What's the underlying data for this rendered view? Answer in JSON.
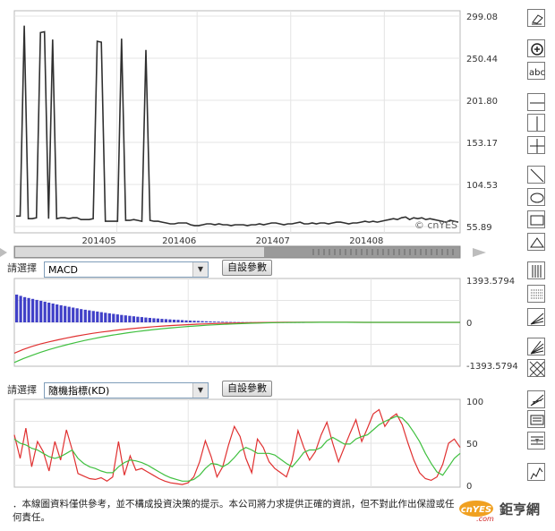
{
  "chart_data": [
    {
      "type": "line",
      "x_ticks": [
        "201405",
        "201406",
        "201407",
        "201408"
      ],
      "y_ticks": [
        "299.08",
        "250.44",
        "201.80",
        "153.17",
        "104.53",
        "55.89"
      ],
      "ylim": [
        55.89,
        299.08
      ],
      "watermark": "© cnYES",
      "series": [
        {
          "values": [
            68,
            68,
            288,
            65,
            65,
            66,
            280,
            281,
            65,
            272,
            65,
            66,
            66,
            65,
            66,
            66,
            64,
            64,
            64,
            65,
            270,
            269,
            62,
            62,
            62,
            62,
            273,
            63,
            63,
            64,
            63,
            62,
            260,
            63,
            62,
            62,
            61,
            60,
            59,
            59,
            60,
            60,
            60,
            58,
            57,
            57,
            58,
            59,
            59,
            58,
            59,
            58,
            58,
            57,
            58,
            58,
            58,
            57,
            58,
            58,
            59,
            58,
            59,
            60,
            60,
            59,
            58,
            59,
            59,
            60,
            61,
            59,
            59,
            60,
            59,
            60,
            60,
            59,
            60,
            61,
            61,
            60,
            59,
            60,
            60,
            61,
            62,
            61,
            62,
            61,
            62,
            63,
            64,
            65,
            64,
            66,
            67,
            64,
            66,
            65,
            66,
            64,
            65,
            64,
            63,
            62,
            61,
            63,
            62,
            61
          ]
        }
      ]
    },
    {
      "type": "bar",
      "selector_label": "請選擇",
      "indicator": "MACD",
      "settings_label": "自設參數",
      "y_ticks": [
        "1393.5794",
        "0",
        "-1393.5794"
      ],
      "ylim": [
        -1393.5794,
        1393.5794
      ],
      "histogram": [
        900,
        860,
        820,
        790,
        760,
        730,
        700,
        670,
        640,
        610,
        580,
        555,
        530,
        505,
        480,
        455,
        430,
        410,
        390,
        370,
        350,
        330,
        310,
        292,
        275,
        258,
        242,
        226,
        211,
        197,
        183,
        170,
        158,
        146,
        135,
        124,
        114,
        105,
        96,
        88,
        80,
        72,
        65,
        58,
        52,
        46,
        41,
        36,
        31,
        27,
        23,
        20,
        17,
        14,
        12,
        10,
        8,
        6,
        5,
        4,
        3,
        2,
        2,
        1,
        1,
        1,
        0,
        0,
        0,
        0,
        0,
        0
      ],
      "series": [
        {
          "color": "#e03030",
          "values": [
            -1000,
            -880,
            -780,
            -700,
            -630,
            -565,
            -505,
            -450,
            -400,
            -355,
            -315,
            -278,
            -245,
            -215,
            -188,
            -163,
            -140,
            -120,
            -102,
            -86,
            -72,
            -59,
            -48,
            -38,
            -29,
            -22,
            -16,
            -11,
            -6,
            -3,
            0,
            2,
            3,
            4,
            4,
            4,
            3,
            3,
            2,
            2,
            1,
            1,
            0,
            0,
            0,
            0,
            0,
            0,
            0,
            0,
            0,
            0
          ]
        },
        {
          "color": "#40c040",
          "values": [
            -1300,
            -1180,
            -1070,
            -970,
            -880,
            -800,
            -725,
            -655,
            -590,
            -530,
            -475,
            -425,
            -380,
            -338,
            -300,
            -265,
            -233,
            -204,
            -178,
            -154,
            -132,
            -112,
            -94,
            -78,
            -64,
            -51,
            -40,
            -30,
            -22,
            -15,
            -9,
            -5,
            -2,
            0,
            1,
            2,
            2,
            2,
            2,
            1,
            1,
            0,
            0,
            0,
            0,
            0,
            0,
            0,
            0,
            0,
            0,
            0
          ]
        }
      ]
    },
    {
      "type": "line",
      "selector_label": "請選擇",
      "indicator": "隨機指標(KD)",
      "settings_label": "自設參數",
      "y_ticks": [
        "100",
        "50",
        "0"
      ],
      "ylim": [
        0,
        100
      ],
      "series": [
        {
          "color": "#e03030",
          "values": [
            60,
            32,
            68,
            22,
            52,
            40,
            17,
            52,
            30,
            66,
            42,
            14,
            11,
            8,
            7,
            9,
            5,
            10,
            52,
            12,
            35,
            18,
            20,
            16,
            12,
            8,
            5,
            3,
            2,
            1,
            3,
            10,
            28,
            53,
            34,
            10,
            22,
            48,
            70,
            58,
            32,
            15,
            55,
            45,
            28,
            20,
            15,
            10,
            30,
            65,
            45,
            30,
            40,
            60,
            75,
            50,
            28,
            45,
            62,
            78,
            52,
            68,
            85,
            90,
            70,
            80,
            85,
            72,
            50,
            30,
            15,
            8,
            6,
            10,
            25,
            50,
            55,
            45
          ]
        },
        {
          "color": "#40c040",
          "values": [
            55,
            50,
            48,
            44,
            42,
            38,
            34,
            32,
            34,
            38,
            42,
            32,
            26,
            22,
            20,
            17,
            15,
            15,
            22,
            27,
            30,
            29,
            27,
            24,
            20,
            16,
            12,
            9,
            7,
            5,
            5,
            7,
            12,
            20,
            26,
            25,
            22,
            26,
            33,
            41,
            45,
            42,
            38,
            38,
            38,
            36,
            31,
            26,
            22,
            30,
            39,
            42,
            42,
            45,
            53,
            57,
            53,
            49,
            49,
            55,
            58,
            60,
            66,
            72,
            76,
            79,
            82,
            80,
            73,
            63,
            52,
            38,
            26,
            16,
            12,
            22,
            32,
            38
          ]
        }
      ]
    }
  ],
  "disclaimer": "．本線圖資料僅供參考，並不構成投資決策的提示。本公司將力求提供正確的資訊，但不對此作出保證或任何責任。",
  "logo": {
    "badge": "cnYES",
    "sub": ".com",
    "name": "鉅亨網"
  },
  "toolbar": [
    "eraser-tool",
    "zoom-in-tool",
    "text-tool",
    "horizontal-line-tool",
    "vertical-line-tool",
    "crosshair-tool",
    "trend-line-tool",
    "ellipse-tool",
    "rectangle-tool",
    "triangle-tool",
    "vertical-grid-tool",
    "fibonacci-tool",
    "speed-fan-tool",
    "gann-fan-tool",
    "pattern-tool",
    "fan-lines-tool",
    "channel-tool",
    "text-box-tool",
    "mark-tool"
  ]
}
